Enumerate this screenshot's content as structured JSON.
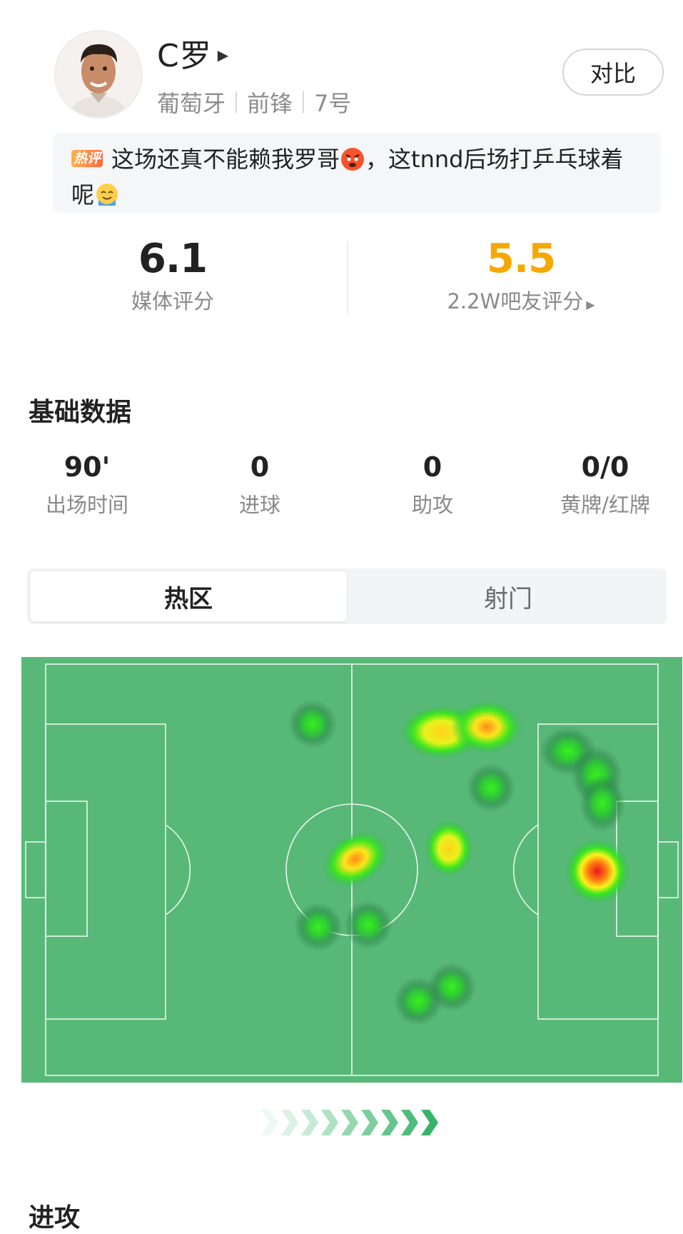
{
  "player": {
    "name": "C罗",
    "nationality": "葡萄牙",
    "position": "前锋",
    "number": "7号"
  },
  "compare_label": "对比",
  "hot_comment": {
    "tag": "热评",
    "text_part1": "这场还真不能赖我罗哥",
    "text_part2": "，这tnnd后场打乒乓球着",
    "text_part3": "呢"
  },
  "ratings": {
    "media": {
      "value": "6.1",
      "label": "媒体评分",
      "color": "#222222"
    },
    "fans": {
      "value": "5.5",
      "label": "2.2W吧友评分",
      "color": "#f6a800"
    }
  },
  "basic_stats": {
    "title": "基础数据",
    "items": [
      {
        "value": "90'",
        "label": "出场时间"
      },
      {
        "value": "0",
        "label": "进球"
      },
      {
        "value": "0",
        "label": "助攻"
      },
      {
        "value": "0/0",
        "label": "黄牌/红牌"
      }
    ]
  },
  "tabs": [
    {
      "label": "热区",
      "active": true
    },
    {
      "label": "射门",
      "active": false
    }
  ],
  "pitch_colors": {
    "grass": "#58b878",
    "lines": "#e9f6ee"
  },
  "next_section_title": "进攻"
}
